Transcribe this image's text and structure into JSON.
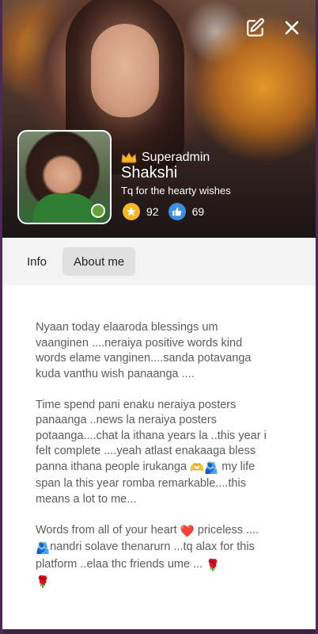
{
  "profile": {
    "role": "Superadmin",
    "name": "Shakshi",
    "status": "Tq for the hearty wishes",
    "stats": {
      "stars": "92",
      "likes": "69"
    },
    "online": true,
    "accent_color": "#66a13a"
  },
  "actions": {
    "edit_icon": "edit-icon",
    "close_icon": "close-icon"
  },
  "tabs": [
    {
      "label": "Info",
      "active": false
    },
    {
      "label": "About me",
      "active": true
    }
  ],
  "about": {
    "paragraphs": [
      {
        "text": "Nyaan today elaaroda blessings um vaanginen ....neraiya positive words kind words elame vanginen....sanda potavanga kuda vanthu wish panaanga ...."
      },
      {
        "text_a": "Time spend pani enaku neraiya posters panaanga ..news la neraiya posters potaanga....chat la ithana years la ..this year i felt complete ....yeah atlast enakaaga bless panna ithana people irukanga ",
        "emoji_1": "🫶",
        "emoji_2": "🫂",
        "text_b": " my life span la this year romba remarkable....this means a lot to me..."
      },
      {
        "text_a": "Words from all of your heart ",
        "emoji_1": "❤️",
        "text_b": " priceless ....",
        "emoji_2": "🫂",
        "text_c": "nandri solave thenarurn ...tq alax for this platform ..elaa thc friends ume ... ",
        "emoji_3": "🌹",
        "emoji_4": "🌹"
      }
    ]
  }
}
